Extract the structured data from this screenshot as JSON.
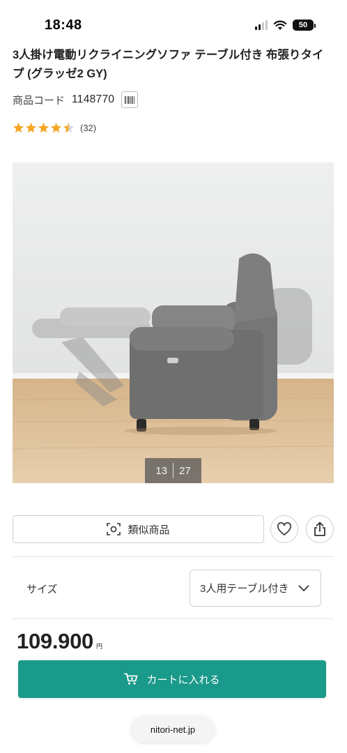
{
  "status_bar": {
    "time": "18:48",
    "battery": "50",
    "signal_bars_on": 2
  },
  "product": {
    "title": "3人掛け電動リクライニングソファ テーブル付き 布張りタイプ (グラッゼ2 GY)",
    "code_label": "商品コード",
    "code_value": "1148770",
    "rating": 4.5,
    "rating_count": "(32)",
    "barcode_icon": "barcode-icon"
  },
  "gallery": {
    "current_image": "13",
    "total_images": "27"
  },
  "actions": {
    "similar_label": "類似商品",
    "similar_icon": "camera-scan-icon",
    "favorite_icon": "heart-icon",
    "share_icon": "share-icon"
  },
  "size": {
    "label": "サイズ",
    "selected": "3人用テーブル付き"
  },
  "price": {
    "value": "109.900",
    "unit": "円"
  },
  "cart": {
    "label": "カートに入れる",
    "icon": "cart-icon"
  },
  "url": {
    "domain": "nitori-net.jp"
  },
  "colors": {
    "accent": "#1a9a8a",
    "star": "#f5a623"
  }
}
